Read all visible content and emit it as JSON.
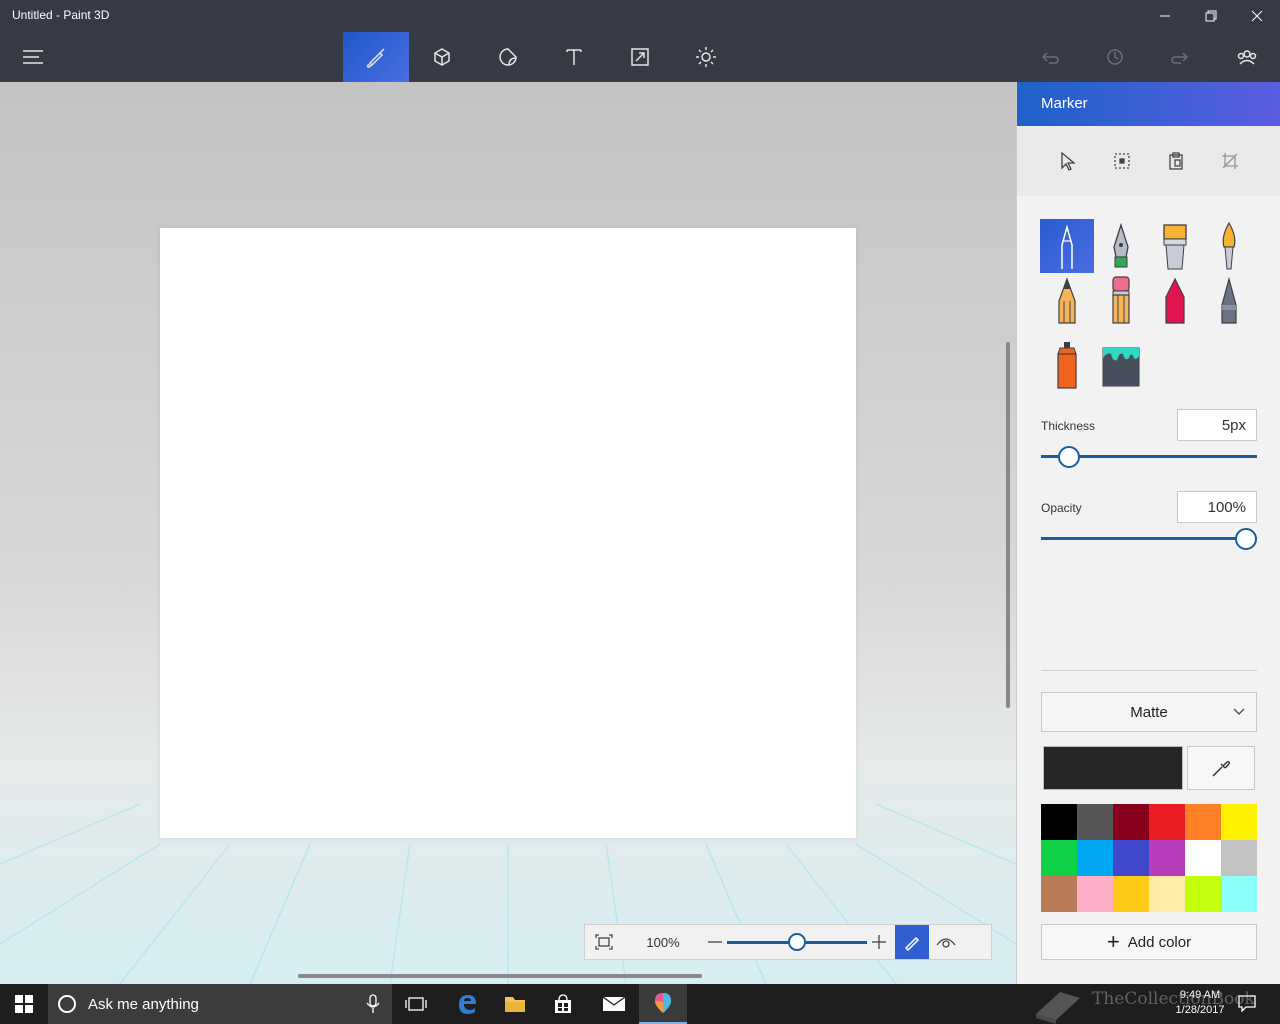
{
  "window": {
    "title": "Untitled - Paint 3D"
  },
  "toolbar": {
    "menu_icon": "hamburger-icon",
    "tools": [
      {
        "name": "brushes",
        "icon": "brush-icon",
        "active": true
      },
      {
        "name": "3d-objects",
        "icon": "cube-icon",
        "active": false
      },
      {
        "name": "stickers",
        "icon": "sticker-icon",
        "active": false
      },
      {
        "name": "text",
        "icon": "text-icon",
        "active": false
      },
      {
        "name": "canvas",
        "icon": "resize-icon",
        "active": false
      },
      {
        "name": "effects",
        "icon": "sun-icon",
        "active": false
      }
    ],
    "right": [
      "undo-icon",
      "history-icon",
      "redo-icon",
      "community-icon"
    ]
  },
  "canvas": {
    "background": "#ffffff"
  },
  "zoom": {
    "value": "100%",
    "level": 0.5
  },
  "panel": {
    "title": "Marker",
    "selection_tools": [
      "select-icon",
      "marquee-icon",
      "paste-icon",
      "crop-icon"
    ],
    "brushes": [
      {
        "name": "marker",
        "selected": true
      },
      {
        "name": "calligraphy-pen",
        "selected": false
      },
      {
        "name": "oil-brush",
        "selected": false
      },
      {
        "name": "watercolor",
        "selected": false
      },
      {
        "name": "pencil",
        "selected": false
      },
      {
        "name": "eraser",
        "selected": false
      },
      {
        "name": "crayon",
        "selected": false
      },
      {
        "name": "pixel-pen",
        "selected": false
      },
      {
        "name": "spray-can",
        "selected": false
      },
      {
        "name": "fill",
        "selected": false
      }
    ],
    "thickness": {
      "label": "Thickness",
      "value": "5px",
      "level": 0.09
    },
    "opacity": {
      "label": "Opacity",
      "value": "100%",
      "level": 1.0
    },
    "finish": {
      "value": "Matte"
    },
    "current_color": "#262626",
    "palette": [
      "#000000",
      "#555555",
      "#88001b",
      "#ec1c24",
      "#ff7f27",
      "#fff200",
      "#0ed145",
      "#00a8f3",
      "#3f48cc",
      "#b83dba",
      "#ffffff",
      "#c3c3c3",
      "#b97a57",
      "#ffaec8",
      "#ffca18",
      "#fdeca6",
      "#c4ff0e",
      "#8cfffb"
    ],
    "add_color": "Add color"
  },
  "taskbar": {
    "search_placeholder": "Ask me anything",
    "apps": [
      "task-view-icon",
      "edge-icon",
      "file-explorer-icon",
      "store-icon",
      "mail-icon",
      "paint3d-icon"
    ],
    "time": "9:49 AM",
    "date": "1/28/2017"
  },
  "watermark": {
    "text": "TheCollectionBook"
  }
}
